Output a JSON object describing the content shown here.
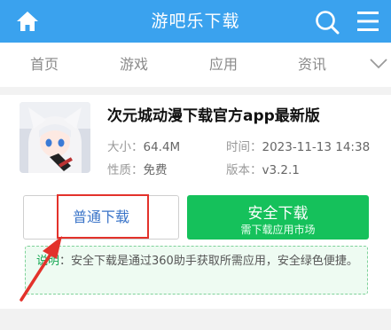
{
  "header": {
    "title": "游吧乐下载",
    "home_icon": "home-icon",
    "search_icon": "search-icon",
    "menu_icon": "menu-icon"
  },
  "nav": {
    "tabs": [
      "首页",
      "游戏",
      "应用",
      "资讯"
    ],
    "more_icon": "chevron-down-icon"
  },
  "app": {
    "title": "次元城动漫下载官方app最新版",
    "size_label": "大小：",
    "size": "64.4M",
    "time_label": "时间：",
    "time": "2023-11-13 14:38",
    "nature_label": "性质：",
    "nature": "免费",
    "version_label": "版本：",
    "version": "v3.2.1"
  },
  "buttons": {
    "normal": "普通下载",
    "safe": "安全下载",
    "safe_sub": "需下载应用市场"
  },
  "notice": {
    "key": "说明",
    "text": "：安全下载是通过360助手获取所需应用，安全绿色便捷。"
  },
  "colors": {
    "header_bg": "#3aa2ee",
    "safe_green": "#15c15b",
    "highlight_red": "#e3322b",
    "link_blue": "#3a74c8"
  }
}
